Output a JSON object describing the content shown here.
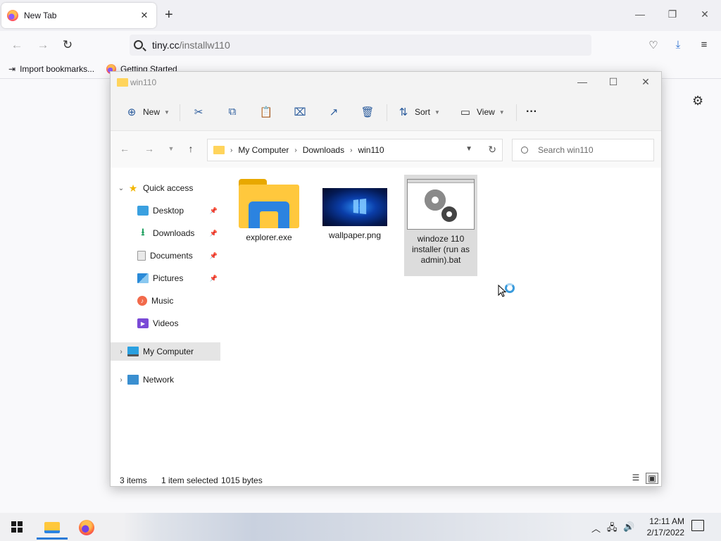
{
  "browser": {
    "tab_title": "New Tab",
    "tab_close": "✕",
    "new_tab": "+",
    "url_domain": "tiny.cc",
    "url_path": "/installw110",
    "bookmarks": [
      {
        "label": "Import bookmarks..."
      },
      {
        "label": "Getting Started"
      }
    ]
  },
  "explorer": {
    "title": "win110",
    "commands": {
      "new": "New",
      "sort": "Sort",
      "view": "View",
      "more": "···"
    },
    "breadcrumb": [
      "My Computer",
      "Downloads",
      "win110"
    ],
    "search_placeholder": "Search win110",
    "nav": {
      "quick_access": "Quick access",
      "items": [
        {
          "label": "Desktop",
          "pinned": true
        },
        {
          "label": "Downloads",
          "pinned": true
        },
        {
          "label": "Documents",
          "pinned": true
        },
        {
          "label": "Pictures",
          "pinned": true
        },
        {
          "label": "Music",
          "pinned": false
        },
        {
          "label": "Videos",
          "pinned": false
        }
      ],
      "my_computer": "My Computer",
      "network": "Network"
    },
    "files": [
      {
        "name": "explorer.exe",
        "icon": "app-folder-icon",
        "selected": false
      },
      {
        "name": "wallpaper.png",
        "icon": "image-thumbnail",
        "selected": false
      },
      {
        "name": "windoze 110 installer (run as admin).bat",
        "icon": "batch-file-icon",
        "selected": true
      }
    ],
    "status": {
      "count": "3 items",
      "selection": "1 item selected",
      "size": "1015 bytes"
    }
  },
  "taskbar": {
    "time": "12:11 AM",
    "date": "2/17/2022"
  },
  "colors": {
    "accent": "#2a7bd8",
    "selection": "#dcdcdc",
    "folder": "#ffc83d"
  }
}
